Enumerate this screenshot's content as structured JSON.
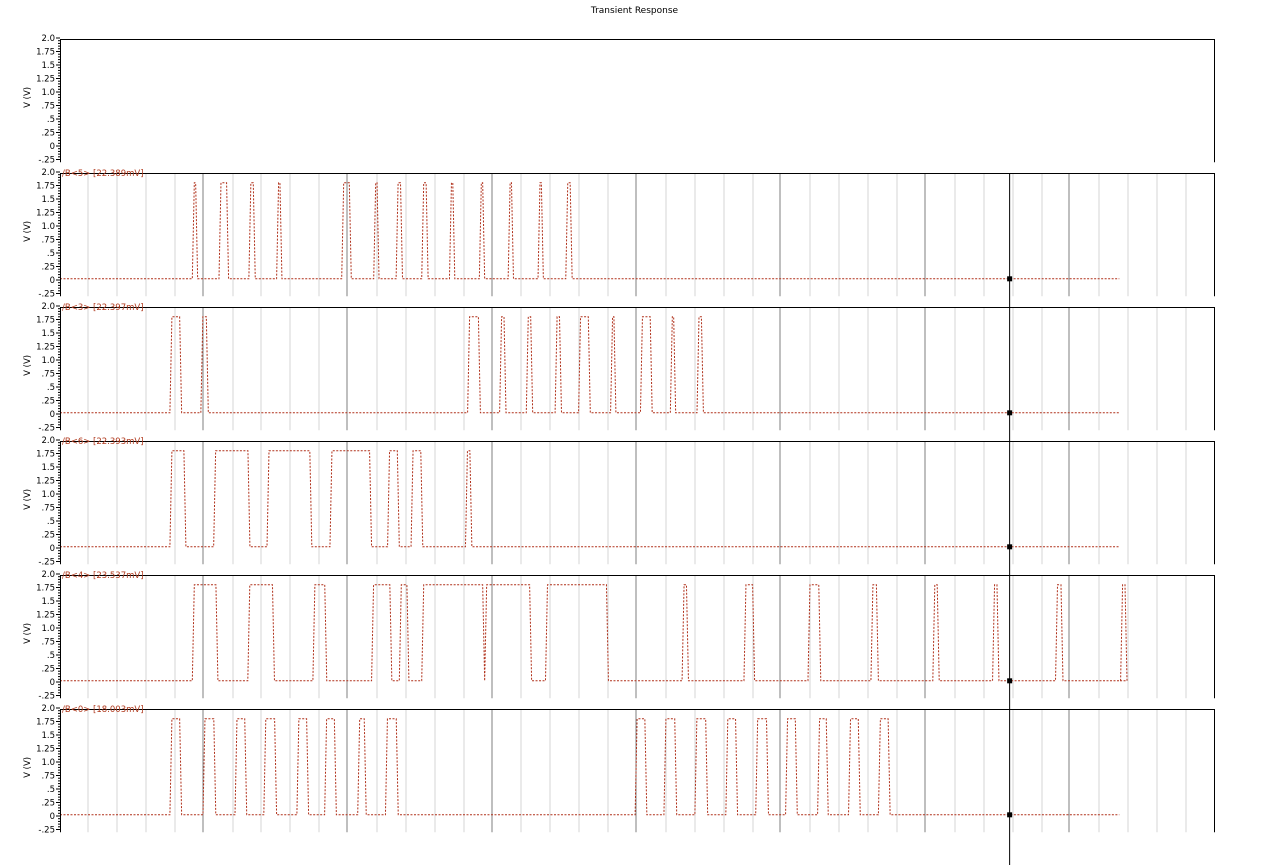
{
  "title": "Transient Response",
  "colors": {
    "trace": "#b0301a",
    "axis": "#000000",
    "grid_major": "#7f7f7f",
    "grid_minor": "#d4d4d4",
    "background": "#ffffff"
  },
  "panels": [
    {
      "label": "",
      "ylabel": "V (V)",
      "ticks": [
        "2.0",
        "1.75",
        "1.5",
        "1.25",
        "1.0",
        ".75",
        ".5",
        ".25",
        "0",
        "-.25"
      ]
    },
    {
      "label": "/B<5> [22.389mV]",
      "ylabel": "V (V)",
      "ticks": [
        "2.0",
        "1.75",
        "1.5",
        "1.25",
        "1.0",
        ".75",
        ".5",
        ".25",
        "0",
        "-.25"
      ]
    },
    {
      "label": "/B<3> [22.397mV]",
      "ylabel": "V (V)",
      "ticks": [
        "2.0",
        "1.75",
        "1.5",
        "1.25",
        "1.0",
        ".75",
        ".5",
        ".25",
        "0",
        "-.25"
      ]
    },
    {
      "label": "/B<6> [22.393mV]",
      "ylabel": "V (V)",
      "ticks": [
        "2.0",
        "1.75",
        "1.5",
        "1.25",
        "1.0",
        ".75",
        ".5",
        ".25",
        "0",
        "-.25"
      ]
    },
    {
      "label": "/B<4> [23.537mV]",
      "ylabel": "V (V)",
      "ticks": [
        "2.0",
        "1.75",
        "1.5",
        "1.25",
        "1.0",
        ".75",
        ".5",
        ".25",
        "0",
        "-.25"
      ]
    },
    {
      "label": "/B<0> [18.003mV]",
      "ylabel": "V (V)",
      "ticks": [
        "2.0",
        "1.75",
        "1.5",
        "1.25",
        "1.0",
        ".75",
        ".5",
        ".25",
        "0",
        "-.25"
      ]
    }
  ],
  "chart_data": {
    "type": "line",
    "title": "Transient Response",
    "ylabel": "V (V)",
    "ylim": [
      -0.3,
      2.0
    ],
    "x_domain": [
      0,
      1000
    ],
    "high_level": 1.8,
    "low_level": 0.022,
    "marker_x": 890,
    "trace_end_x": 930,
    "series": [
      {
        "name": "/B<5> [22.389mV]",
        "marker_value": "22.389mV",
        "pulses": [
          [
            124,
            129
          ],
          [
            149,
            158
          ],
          [
            177,
            183
          ],
          [
            203,
            208
          ],
          [
            264,
            273
          ],
          [
            294,
            299
          ],
          [
            315,
            321
          ],
          [
            339,
            345
          ],
          [
            365,
            370
          ],
          [
            393,
            398
          ],
          [
            420,
            425
          ],
          [
            448,
            453
          ],
          [
            474,
            480
          ]
        ]
      },
      {
        "name": "/B<3> [22.397mV]",
        "marker_value": "22.397mV",
        "pulses": [
          [
            103,
            114
          ],
          [
            132,
            139
          ],
          [
            382,
            394
          ],
          [
            412,
            418
          ],
          [
            437,
            443
          ],
          [
            464,
            470
          ],
          [
            486,
            497
          ],
          [
            516,
            521
          ],
          [
            544,
            555
          ],
          [
            572,
            577
          ],
          [
            597,
            603
          ]
        ]
      },
      {
        "name": "/B<6> [22.393mV]",
        "marker_value": "22.393mV",
        "pulses": [
          [
            103,
            118
          ],
          [
            144,
            178
          ],
          [
            194,
            236
          ],
          [
            253,
            292
          ],
          [
            307,
            318
          ],
          [
            329,
            340
          ],
          [
            380,
            386
          ]
        ]
      },
      {
        "name": "/B<4> [23.537mV]",
        "marker_value": "23.537mV",
        "pulses": [
          [
            124,
            148
          ],
          [
            176,
            201
          ],
          [
            237,
            250
          ],
          [
            292,
            311
          ],
          [
            318,
            327
          ],
          [
            339,
            398
          ],
          [
            398,
            442
          ],
          [
            455,
            514
          ],
          [
            583,
            589
          ],
          [
            641,
            651
          ],
          [
            701,
            713
          ],
          [
            760,
            767
          ],
          [
            818,
            824
          ],
          [
            874,
            880
          ],
          [
            933,
            940
          ],
          [
            994,
            1000
          ]
        ]
      },
      {
        "name": "/B<0> [18.003mV]",
        "marker_value": "18.003mV",
        "pulses": [
          [
            103,
            114
          ],
          [
            134,
            146
          ],
          [
            164,
            175
          ],
          [
            191,
            203
          ],
          [
            222,
            233
          ],
          [
            248,
            259
          ],
          [
            279,
            287
          ],
          [
            305,
            317
          ],
          [
            539,
            550
          ],
          [
            566,
            578
          ],
          [
            595,
            607
          ],
          [
            624,
            635
          ],
          [
            652,
            664
          ],
          [
            680,
            691
          ],
          [
            710,
            720
          ],
          [
            739,
            750
          ],
          [
            767,
            778
          ]
        ]
      }
    ]
  }
}
